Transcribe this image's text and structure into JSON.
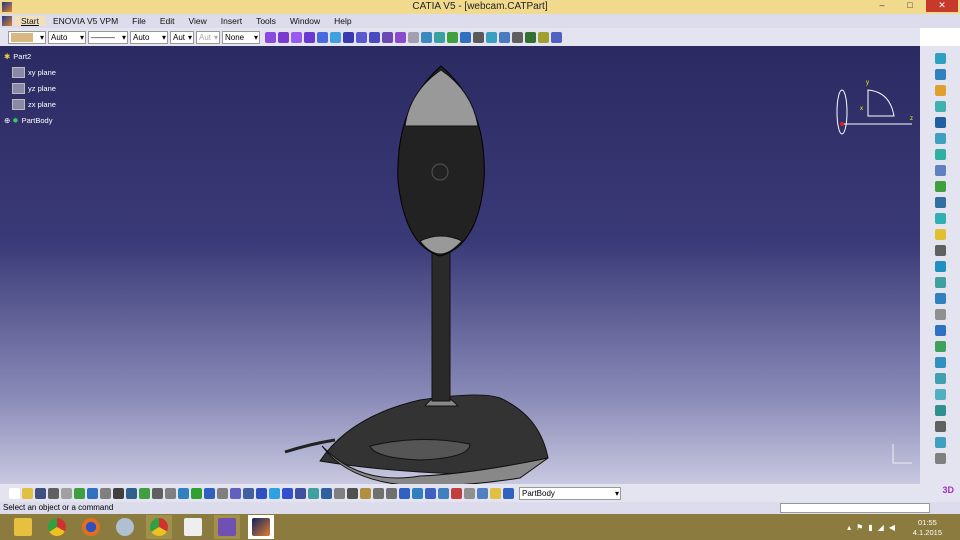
{
  "window": {
    "title": "CATIA V5 - [webcam.CATPart]",
    "minimize": "–",
    "maximize": "□",
    "close": "✕"
  },
  "menu": [
    "Start",
    "ENOVIA V5 VPM",
    "File",
    "Edit",
    "View",
    "Insert",
    "Tools",
    "Window",
    "Help"
  ],
  "toolbar": {
    "color_value": "",
    "line_type": "———",
    "weight1": "Auto",
    "weight2": "Auto",
    "thickness1": "Aut",
    "thickness2": "Aut",
    "layer": "None",
    "fill_color": "#d8b880"
  },
  "tree": {
    "root": "Part2",
    "items": [
      "xy plane",
      "yz plane",
      "zx plane"
    ],
    "body": "PartBody"
  },
  "compass": {
    "x": "x",
    "y": "y",
    "z": "z"
  },
  "bottom": {
    "current_body": "PartBody"
  },
  "status": {
    "message": "Select an object or a command"
  },
  "taskbar": {
    "apps": [
      "file-explorer",
      "chrome",
      "firefox",
      "paint",
      "chrome",
      "app",
      "visual-studio",
      "catia"
    ],
    "time": "01:55",
    "date": "4.1.2015"
  },
  "icons": {
    "top_colors": [
      "#8a4ae0",
      "#7a3ad0",
      "#9a5af0",
      "#6a3ad0",
      "#4a6ae0",
      "#40a0e0",
      "#3a3ab0",
      "#5a5ad0",
      "#4a4ac0",
      "#6a4ab0",
      "#8a4ad0",
      "#a0a0b0",
      "#3a8ac0",
      "#3aa0a0",
      "#40a040",
      "#3070c0",
      "#5a5a5a",
      "#3aa0c0",
      "#4a7ac0",
      "#606060",
      "#307030",
      "#a0a030",
      "#5060c0"
    ],
    "right_colors": [
      "#30a0c0",
      "#3080c0",
      "#e0a030",
      "#40b0b0",
      "#2060a0",
      "#40a0c0",
      "#30b0a0",
      "#6080c0",
      "#40a040",
      "#3070a0",
      "#30b0b0",
      "#e0c030",
      "#606060",
      "#2090c0",
      "#40a0a0",
      "#3080c0",
      "#909090",
      "#3070c0",
      "#40a060",
      "#3090c0",
      "#40a0b0",
      "#50b0c0",
      "#309090",
      "#606060",
      "#40a0c0",
      "#808080"
    ],
    "bottom_colors": [
      "#ffffff",
      "#e0c040",
      "#405080",
      "#606060",
      "#a0a0a0",
      "#40a040",
      "#3070c0",
      "#808080",
      "#404040",
      "#306090",
      "#40a040",
      "#606060",
      "#808080",
      "#3080c0",
      "#30a030",
      "#3060c0",
      "#808080",
      "#6060c0",
      "#4060a0",
      "#3050c0",
      "#30a0e0",
      "#3050d0",
      "#4050a0",
      "#40a0a0",
      "#3060a0",
      "#808080",
      "#505050",
      "#b09040",
      "#707070",
      "#707070",
      "#3060c0",
      "#3080c0",
      "#4060c0",
      "#4080c0",
      "#c04040",
      "#909090",
      "#5080c0",
      "#e0c040",
      "#3060c0"
    ]
  }
}
